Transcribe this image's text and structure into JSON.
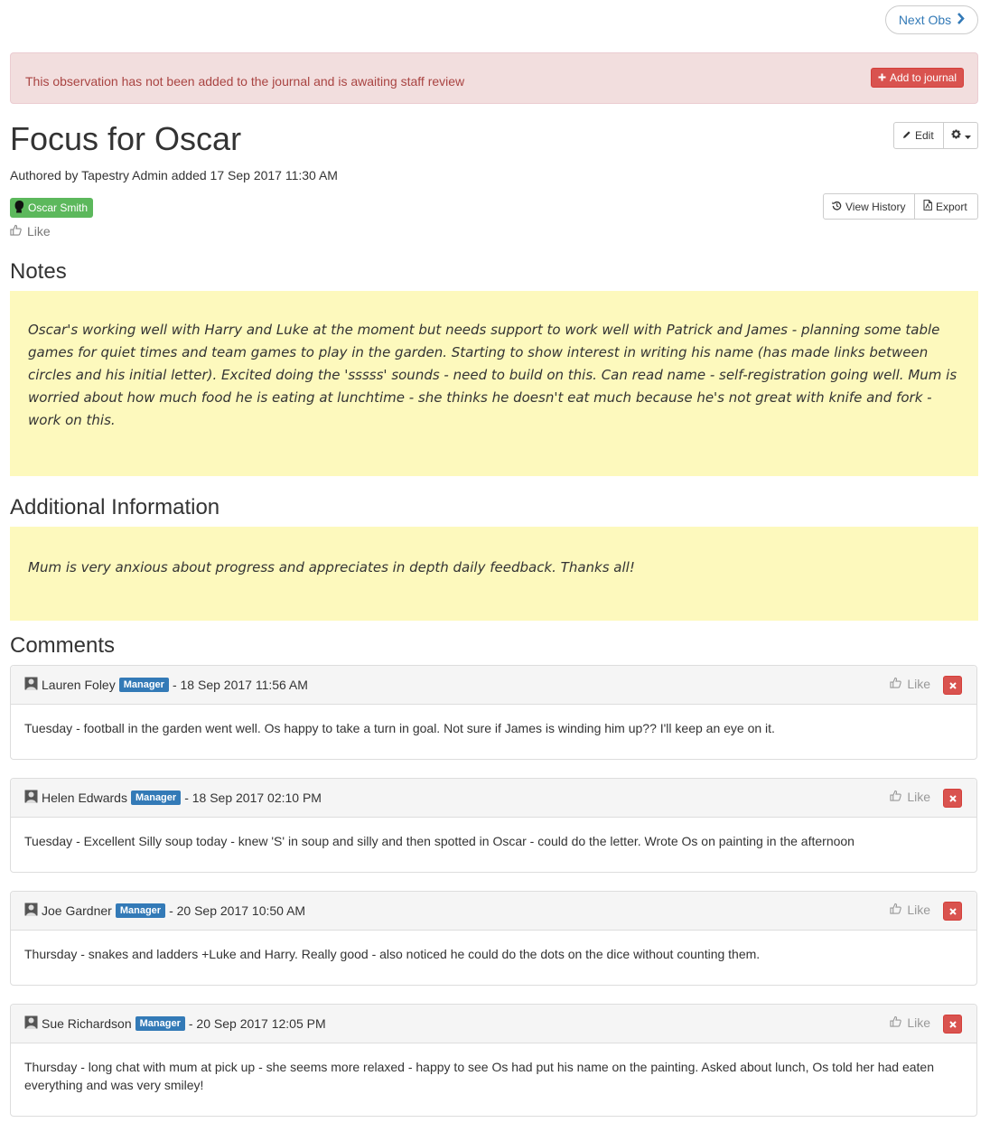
{
  "nav": {
    "next_obs_label": "Next Obs"
  },
  "alert": {
    "message": "This observation has not been added to the journal and is awaiting staff review",
    "add_button_label": "Add to journal"
  },
  "observation": {
    "title": "Focus for Oscar",
    "edit_label": "Edit",
    "author_line": "Authored by Tapestry Admin added 17 Sep 2017 11:30 AM",
    "child_name": "Oscar Smith",
    "like_label": "Like",
    "view_history_label": "View History",
    "export_label": "Export"
  },
  "notes": {
    "heading": "Notes",
    "text": "Oscar's working well with Harry and Luke at the moment but needs support to work well with Patrick and James - planning some table games for quiet times and team games to play in the garden. Starting to show interest in writing his name (has made links between circles and his initial letter). Excited doing the 'sssss' sounds - need to build on this. Can read name - self-registration going well. Mum is worried about how much food he is eating at lunchtime - she thinks he doesn't eat much because he's not great with knife and fork - work on this."
  },
  "additional": {
    "heading": "Additional Information",
    "text": "Mum is very anxious about progress and appreciates in depth daily feedback. Thanks all!"
  },
  "comments": {
    "heading": "Comments",
    "like_label": "Like",
    "items": [
      {
        "author": "Lauren Foley",
        "role": "Manager",
        "date": "- 18 Sep 2017 11:56 AM",
        "text": "Tuesday - football in the garden went well. Os happy to take a turn in goal. Not sure if James is winding him up?? I'll keep an eye on it."
      },
      {
        "author": "Helen Edwards",
        "role": "Manager",
        "date": "- 18 Sep 2017  02:10 PM",
        "text": "Tuesday - Excellent Silly soup today - knew 'S' in soup and silly and then spotted in Oscar - could do the letter. Wrote Os on painting in the afternoon"
      },
      {
        "author": "Joe Gardner",
        "role": "Manager",
        "date": "- 20 Sep 2017  10:50 AM",
        "text": "Thursday - snakes and ladders +Luke and Harry. Really good - also noticed he could do the dots on the dice without counting them."
      },
      {
        "author": "Sue Richardson",
        "role": "Manager",
        "date": "- 20 Sep 2017 12:05 PM",
        "text": "Thursday - long chat with mum at pick up - she seems more relaxed - happy to see Os had put his name on the painting. Asked about lunch, Os told her had eaten everything and was very smiley!"
      }
    ]
  }
}
